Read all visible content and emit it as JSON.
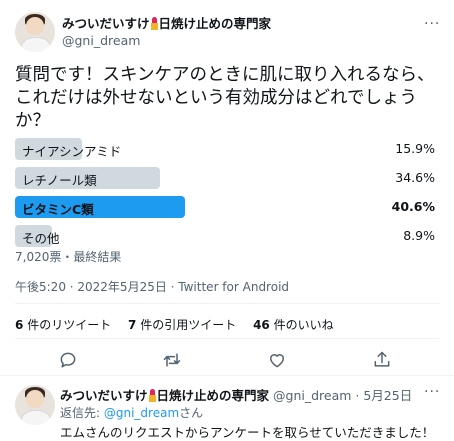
{
  "tweet": {
    "author_name": "みついだいすけ",
    "author_name_suffix": "日焼け止めの専門家",
    "author_handle": "@gni_dream",
    "text_lines": [
      "質問です！スキンケアのときに肌に取り入れるなら、",
      "これだけは外せないという有効成分はどれでしょう",
      "か？"
    ],
    "poll": {
      "options": [
        {
          "label": "ナイアシンアミド",
          "percent_text": "15.9%",
          "percent": 15.9,
          "winner": false
        },
        {
          "label": "レチノール類",
          "percent_text": "34.6%",
          "percent": 34.6,
          "winner": false
        },
        {
          "label": "ビタミンC類",
          "percent_text": "40.6%",
          "percent": 40.6,
          "winner": true
        },
        {
          "label": "その他",
          "percent_text": "8.9%",
          "percent": 8.9,
          "winner": false
        }
      ],
      "summary": "7,020票・最終結果"
    },
    "meta": "午後5:20 · 2022年5月25日 · Twitter for Android",
    "stats": {
      "retweets_count": "6",
      "retweets_label": "件のリツイート",
      "quotes_count": "7",
      "quotes_label": "件の引用ツイート",
      "likes_count": "46",
      "likes_label": "件のいいね"
    },
    "actions": [
      "reply-icon",
      "retweet-icon",
      "like-icon",
      "share-icon"
    ],
    "more_label": "···"
  },
  "reply": {
    "author_name": "みついだいすけ",
    "author_name_suffix": "日焼け止めの専門家",
    "author_handle_time": "@gni_dream · 5月25日",
    "reply_to_prefix": "返信先: ",
    "reply_to_handle": "@gni_dream",
    "reply_to_suffix": "さん",
    "text": "エムさんのリクエストからアンケートを取らせていただきました！"
  },
  "colors": {
    "accent": "#1d9bf0",
    "poll_bar": "#cfd9de",
    "text": "#0f1419",
    "muted": "#536471"
  }
}
